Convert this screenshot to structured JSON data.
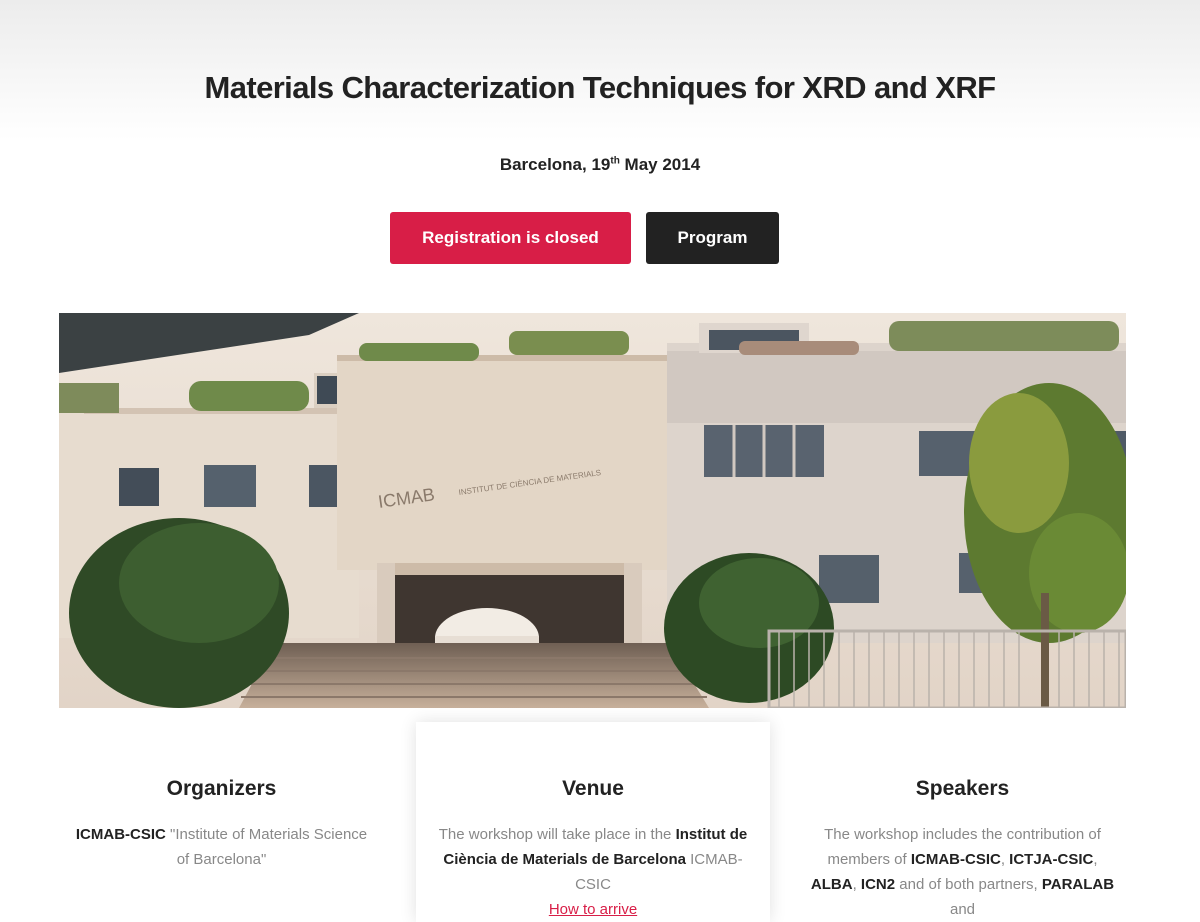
{
  "header": {
    "title": "Materials Characterization Techniques for XRD and XRF",
    "location_prefix": "Barcelona, 19",
    "date_sup": "th",
    "date_suffix": " May 2014"
  },
  "buttons": {
    "registration_label": "Registration is closed",
    "program_label": "Program"
  },
  "hero": {
    "sign_left": "ICMAB",
    "sign_right": "INSTITUT DE CIÈNCIA DE MATERIALS"
  },
  "organizers": {
    "heading": "Organizers",
    "org_bold": "ICMAB-CSIC",
    "org_text": " \"Institute of Materials Science of Barcelona\""
  },
  "venue": {
    "heading": "Venue",
    "text_1": "The workshop will take place in the ",
    "institute_bold": "Institut de Ciència de Materials de Barcelona",
    "text_2": " ICMAB- CSIC",
    "link": "How to arrive"
  },
  "speakers": {
    "heading": "Speakers",
    "text_1": "The workshop includes the contribution of members of ",
    "s1": "ICMAB-CSIC",
    "sep1": ", ",
    "s2": "ICTJA-CSIC",
    "sep2": ", ",
    "s3": "ALBA",
    "sep3": ", ",
    "s4": "ICN2",
    "text_2": " and of both partners, ",
    "s5": "PARALAB",
    "text_3": " and"
  },
  "colors": {
    "accent": "#d81e47",
    "dark": "#222222",
    "muted_text": "#888888"
  }
}
